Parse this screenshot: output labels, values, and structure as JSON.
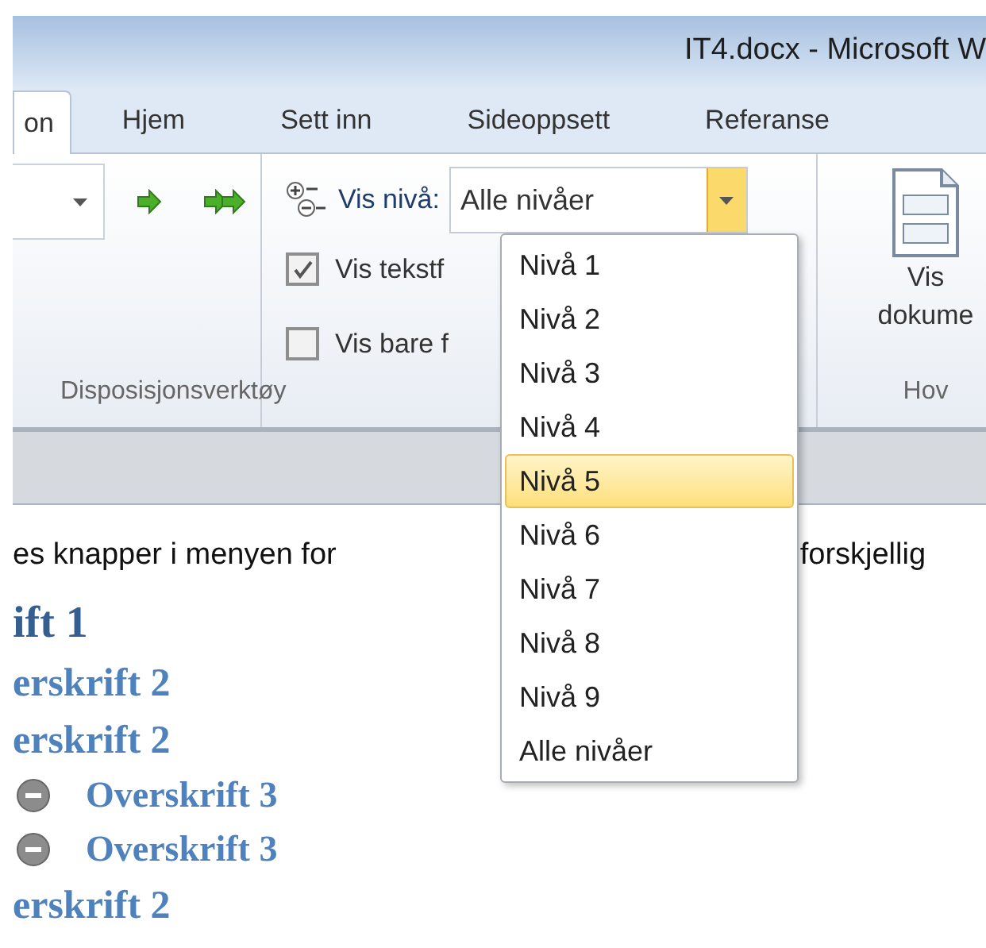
{
  "window": {
    "title": "IT4.docx - Microsoft W"
  },
  "tabs": [
    {
      "label": "on",
      "selected": true
    },
    {
      "label": "Hjem",
      "selected": false
    },
    {
      "label": "Sett inn",
      "selected": false
    },
    {
      "label": "Sideoppsett",
      "selected": false
    },
    {
      "label": "Referanse",
      "selected": false
    }
  ],
  "outline_tools": {
    "level_label": "Vis nivå:",
    "level_value": "Alle nivåer",
    "checkboxes": [
      {
        "label": "Vis tekstf",
        "checked": true
      },
      {
        "label": "Vis bare f",
        "checked": false
      }
    ],
    "group_label": "Disposisjonsverktøy"
  },
  "show_document": {
    "label_lines": [
      "Vis",
      "dokume"
    ],
    "group_label": "Hov"
  },
  "level_menu": [
    {
      "label": "Nivå 1",
      "selected": false
    },
    {
      "label": "Nivå 2",
      "selected": false
    },
    {
      "label": "Nivå 3",
      "selected": false
    },
    {
      "label": "Nivå 4",
      "selected": false
    },
    {
      "label": "Nivå 5",
      "selected": true
    },
    {
      "label": "Nivå 6",
      "selected": false
    },
    {
      "label": "Nivå 7",
      "selected": false
    },
    {
      "label": "Nivå 8",
      "selected": false
    },
    {
      "label": "Nivå 9",
      "selected": false
    },
    {
      "label": "Alle nivåer",
      "selected": false
    }
  ],
  "document": [
    {
      "kind": "body",
      "text": "es knapper i menyen for",
      "text_end": "forskjellig"
    },
    {
      "kind": "heading1",
      "text": "ift 1"
    },
    {
      "kind": "heading2",
      "text": "erskrift 2"
    },
    {
      "kind": "heading2",
      "text": "erskrift 2"
    },
    {
      "kind": "heading3",
      "text": "Overskrift 3",
      "expanded": true
    },
    {
      "kind": "heading3",
      "text": "Overskrift 3",
      "expanded": true
    },
    {
      "kind": "heading2",
      "text": "erskrift 2"
    }
  ]
}
